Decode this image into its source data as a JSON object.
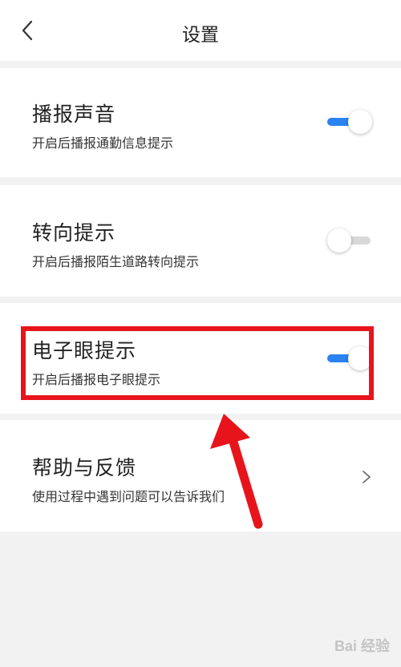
{
  "header": {
    "title": "设置",
    "back_icon": "chevron-left-icon"
  },
  "settings": [
    {
      "title": "播报声音",
      "subtitle": "开启后播报通勤信息提示",
      "toggle_on": true
    },
    {
      "title": "转向提示",
      "subtitle": "开启后播报陌生道路转向提示",
      "toggle_on": false
    },
    {
      "title": "电子眼提示",
      "subtitle": "开启后播报电子眼提示",
      "toggle_on": true
    }
  ],
  "help": {
    "title": "帮助与反馈",
    "subtitle": "使用过程中遇到问题可以告诉我们",
    "chevron_icon": "chevron-right-icon"
  },
  "watermark": "Bai 经验",
  "colors": {
    "accent": "#2a83f0",
    "track_off": "#d8d8d8",
    "highlight": "#e8141c",
    "arrow": "#e8141c"
  }
}
